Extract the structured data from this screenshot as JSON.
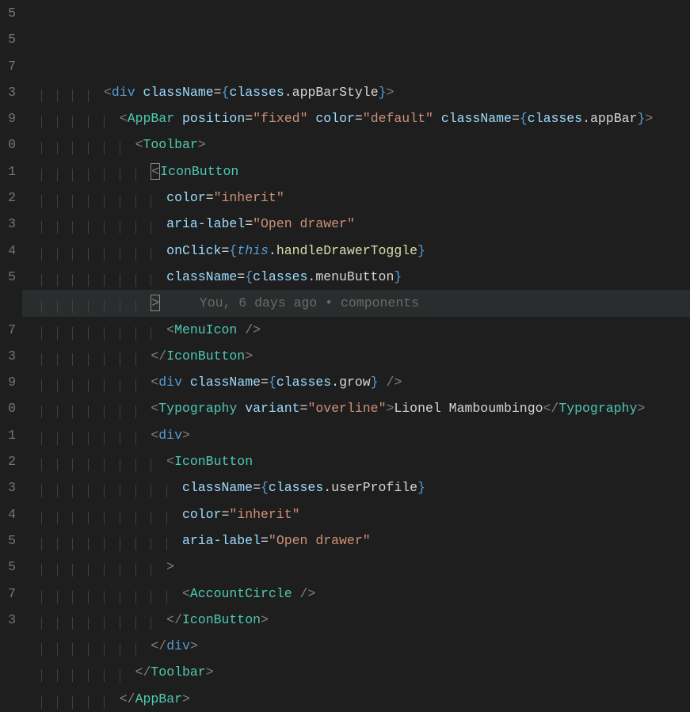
{
  "gutter": {
    "line_numbers": [
      "5",
      "5",
      "7",
      "3",
      "9",
      "0",
      "1",
      "2",
      "3",
      "4",
      "5",
      "",
      "7",
      "3",
      "9",
      "0",
      "1",
      "2",
      "3",
      "4",
      "5",
      "5",
      "7",
      "3"
    ]
  },
  "blame": {
    "text": "You, 6 days ago • components"
  },
  "code": {
    "lines": [
      {
        "indent": 5,
        "tokens": [
          [
            "<",
            "p-gray"
          ],
          [
            "div",
            "p-blue"
          ],
          [
            " ",
            ""
          ],
          [
            "className",
            "p-attr"
          ],
          [
            "=",
            "p-white"
          ],
          [
            "{",
            "p-blue"
          ],
          [
            "classes",
            "p-ident"
          ],
          [
            ".",
            "p-white"
          ],
          [
            "appBarStyle",
            "p-field"
          ],
          [
            "}",
            "p-blue"
          ],
          [
            ">",
            "p-gray"
          ]
        ]
      },
      {
        "indent": 6,
        "tokens": [
          [
            "<",
            "p-gray"
          ],
          [
            "AppBar",
            "p-teal"
          ],
          [
            " ",
            ""
          ],
          [
            "position",
            "p-attr"
          ],
          [
            "=",
            "p-white"
          ],
          [
            "\"",
            "p-str"
          ],
          [
            "fixed",
            "p-str"
          ],
          [
            "\"",
            "p-str"
          ],
          [
            " ",
            ""
          ],
          [
            "color",
            "p-attr"
          ],
          [
            "=",
            "p-white"
          ],
          [
            "\"",
            "p-str"
          ],
          [
            "default",
            "p-str"
          ],
          [
            "\"",
            "p-str"
          ],
          [
            " ",
            ""
          ],
          [
            "className",
            "p-attr"
          ],
          [
            "=",
            "p-white"
          ],
          [
            "{",
            "p-blue"
          ],
          [
            "classes",
            "p-ident"
          ],
          [
            ".",
            "p-white"
          ],
          [
            "appBar",
            "p-field"
          ],
          [
            "}",
            "p-blue"
          ],
          [
            ">",
            "p-gray"
          ]
        ]
      },
      {
        "indent": 7,
        "tokens": [
          [
            "<",
            "p-gray"
          ],
          [
            "Toolbar",
            "p-teal"
          ],
          [
            ">",
            "p-gray"
          ]
        ]
      },
      {
        "indent": 8,
        "tokens": [
          [
            "<",
            "p-gray bracket-match"
          ],
          [
            "IconButton",
            "p-teal"
          ]
        ]
      },
      {
        "indent": 9,
        "tokens": [
          [
            "color",
            "p-attr"
          ],
          [
            "=",
            "p-white"
          ],
          [
            "\"",
            "p-str"
          ],
          [
            "inherit",
            "p-str"
          ],
          [
            "\"",
            "p-str"
          ]
        ]
      },
      {
        "indent": 9,
        "tokens": [
          [
            "aria-label",
            "p-attr"
          ],
          [
            "=",
            "p-white"
          ],
          [
            "\"",
            "p-str"
          ],
          [
            "Open drawer",
            "p-str"
          ],
          [
            "\"",
            "p-str"
          ]
        ]
      },
      {
        "indent": 9,
        "tokens": [
          [
            "onClick",
            "p-attr"
          ],
          [
            "=",
            "p-white"
          ],
          [
            "{",
            "p-blue"
          ],
          [
            "this",
            "p-this"
          ],
          [
            ".",
            "p-white"
          ],
          [
            "handleDrawerToggle",
            "p-var"
          ],
          [
            "}",
            "p-blue"
          ]
        ]
      },
      {
        "indent": 9,
        "tokens": [
          [
            "className",
            "p-attr"
          ],
          [
            "=",
            "p-white"
          ],
          [
            "{",
            "p-blue"
          ],
          [
            "classes",
            "p-ident"
          ],
          [
            ".",
            "p-white"
          ],
          [
            "menuButton",
            "p-field"
          ],
          [
            "}",
            "p-blue"
          ]
        ]
      },
      {
        "indent": 8,
        "current": true,
        "tokens": [
          [
            ">",
            "p-gray bracket-match"
          ],
          [
            "     ",
            "p-white"
          ],
          [
            "You, 6 days ago • components",
            "p-dim blame"
          ]
        ]
      },
      {
        "indent": 9,
        "tokens": [
          [
            "<",
            "p-gray"
          ],
          [
            "MenuIcon",
            "p-teal"
          ],
          [
            " ",
            ""
          ],
          [
            "/>",
            "p-gray"
          ]
        ]
      },
      {
        "indent": 8,
        "tokens": [
          [
            "</",
            "p-gray"
          ],
          [
            "IconButton",
            "p-teal"
          ],
          [
            ">",
            "p-gray"
          ]
        ]
      },
      {
        "indent": 8,
        "tokens": [
          [
            "<",
            "p-gray"
          ],
          [
            "div",
            "p-blue"
          ],
          [
            " ",
            ""
          ],
          [
            "className",
            "p-attr"
          ],
          [
            "=",
            "p-white"
          ],
          [
            "{",
            "p-blue"
          ],
          [
            "classes",
            "p-ident"
          ],
          [
            ".",
            "p-white"
          ],
          [
            "grow",
            "p-field"
          ],
          [
            "}",
            "p-blue"
          ],
          [
            " ",
            ""
          ],
          [
            "/>",
            "p-gray"
          ]
        ]
      },
      {
        "indent": 8,
        "tokens": [
          [
            "<",
            "p-gray"
          ],
          [
            "Typography",
            "p-teal"
          ],
          [
            " ",
            ""
          ],
          [
            "variant",
            "p-attr"
          ],
          [
            "=",
            "p-white"
          ],
          [
            "\"",
            "p-str"
          ],
          [
            "overline",
            "p-str"
          ],
          [
            "\"",
            "p-str"
          ],
          [
            ">",
            "p-gray"
          ],
          [
            "Lionel Mamboumbingo",
            "p-white"
          ],
          [
            "</",
            "p-gray"
          ],
          [
            "Typography",
            "p-teal"
          ],
          [
            ">",
            "p-gray"
          ]
        ]
      },
      {
        "indent": 8,
        "tokens": [
          [
            "<",
            "p-gray"
          ],
          [
            "div",
            "p-blue"
          ],
          [
            ">",
            "p-gray"
          ]
        ]
      },
      {
        "indent": 9,
        "tokens": [
          [
            "<",
            "p-gray"
          ],
          [
            "IconButton",
            "p-teal"
          ]
        ]
      },
      {
        "indent": 10,
        "tokens": [
          [
            "className",
            "p-attr"
          ],
          [
            "=",
            "p-white"
          ],
          [
            "{",
            "p-blue"
          ],
          [
            "classes",
            "p-ident"
          ],
          [
            ".",
            "p-white"
          ],
          [
            "userProfile",
            "p-field"
          ],
          [
            "}",
            "p-blue"
          ]
        ]
      },
      {
        "indent": 10,
        "tokens": [
          [
            "color",
            "p-attr"
          ],
          [
            "=",
            "p-white"
          ],
          [
            "\"",
            "p-str"
          ],
          [
            "inherit",
            "p-str"
          ],
          [
            "\"",
            "p-str"
          ]
        ]
      },
      {
        "indent": 10,
        "tokens": [
          [
            "aria-label",
            "p-attr"
          ],
          [
            "=",
            "p-white"
          ],
          [
            "\"",
            "p-str"
          ],
          [
            "Open drawer",
            "p-str"
          ],
          [
            "\"",
            "p-str"
          ]
        ]
      },
      {
        "indent": 9,
        "tokens": [
          [
            ">",
            "p-gray"
          ]
        ]
      },
      {
        "indent": 10,
        "tokens": [
          [
            "<",
            "p-gray"
          ],
          [
            "AccountCircle",
            "p-teal"
          ],
          [
            " ",
            ""
          ],
          [
            "/>",
            "p-gray"
          ]
        ]
      },
      {
        "indent": 9,
        "tokens": [
          [
            "</",
            "p-gray"
          ],
          [
            "IconButton",
            "p-teal"
          ],
          [
            ">",
            "p-gray"
          ]
        ]
      },
      {
        "indent": 8,
        "tokens": [
          [
            "</",
            "p-gray"
          ],
          [
            "div",
            "p-blue"
          ],
          [
            ">",
            "p-gray"
          ]
        ]
      },
      {
        "indent": 7,
        "tokens": [
          [
            "</",
            "p-gray"
          ],
          [
            "Toolbar",
            "p-teal"
          ],
          [
            ">",
            "p-gray"
          ]
        ]
      },
      {
        "indent": 6,
        "tokens": [
          [
            "</",
            "p-gray"
          ],
          [
            "AppBar",
            "p-teal"
          ],
          [
            ">",
            "p-gray"
          ]
        ]
      }
    ]
  }
}
